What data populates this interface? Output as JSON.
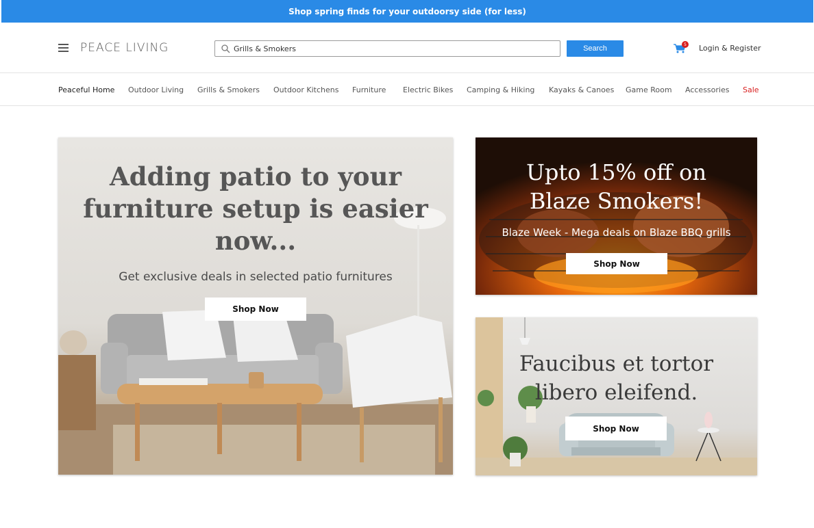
{
  "promo": {
    "text": "Shop spring finds for your outdoorsy side (for less)"
  },
  "header": {
    "brand": "PEACE LIVING",
    "search": {
      "value": "Grills & Smokers",
      "button_label": "Search"
    },
    "cart": {
      "count": "5"
    },
    "login_label": "Login & Register"
  },
  "nav": {
    "items": [
      {
        "label": "Peaceful Home"
      },
      {
        "label": "Outdoor Living"
      },
      {
        "label": "Grills & Smokers"
      },
      {
        "label": "Outdoor Kitchens"
      },
      {
        "label": "Furniture"
      },
      {
        "label": "Electric Bikes"
      },
      {
        "label": "Camping & Hiking"
      },
      {
        "label": "Kayaks & Canoes"
      },
      {
        "label": "Game Room"
      },
      {
        "label": "Accessories"
      },
      {
        "label": "Sale"
      }
    ]
  },
  "hero": {
    "title_line1": "Adding patio to your",
    "title_line2": "furniture setup is easier",
    "title_line3": "now...",
    "subtitle": "Get exclusive deals in selected patio furnitures",
    "button_label": "Shop Now"
  },
  "promo_grill": {
    "title_line1": "Upto 15% off on",
    "title_line2": "Blaze Smokers!",
    "subtitle": "Blaze Week - Mega deals on Blaze BBQ grills",
    "button_label": "Shop Now"
  },
  "promo_room": {
    "title_line1": "Faucibus et tortor",
    "title_line2": "libero eleifend.",
    "button_label": "Shop Now"
  },
  "colors": {
    "accent": "#2a8ae6",
    "sale": "#d81e1e"
  }
}
